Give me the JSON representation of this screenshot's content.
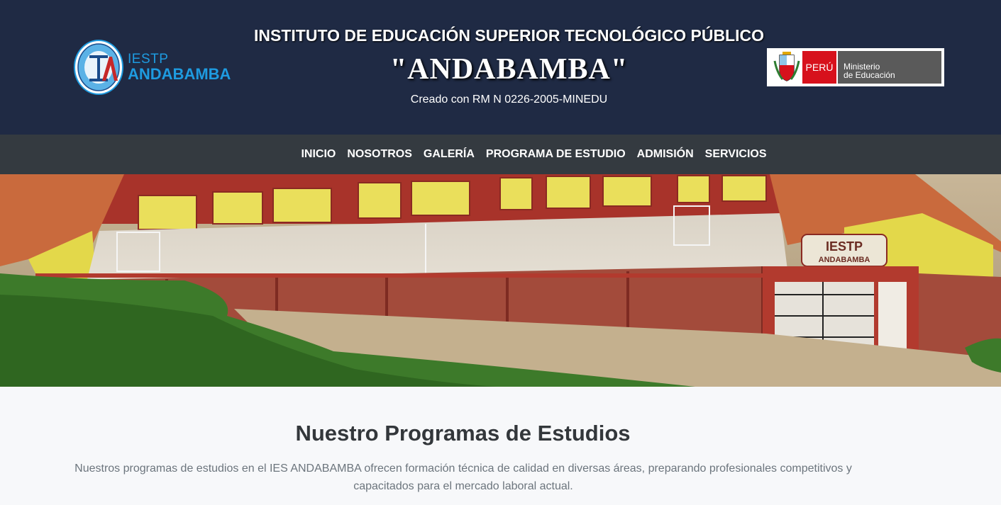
{
  "header": {
    "logo": {
      "line1": "IESTP",
      "line2": "ANDABAMBA"
    },
    "title_line1": "INSTITUTO DE EDUCACIÓN SUPERIOR TECNOLÓGICO PÚBLICO",
    "title_line2": "\"ANDABAMBA\"",
    "subtitle": "Creado con RM N 0226-2005-MINEDU",
    "minedu": {
      "country": "PERÚ",
      "line1": "Ministerio",
      "line2": "de Educación"
    },
    "bg_color": "#1f2a44"
  },
  "nav": {
    "items": [
      {
        "label": "INICIO"
      },
      {
        "label": "NOSOTROS"
      },
      {
        "label": "GALERÍA"
      },
      {
        "label": "PROGRAMA DE ESTUDIO"
      },
      {
        "label": "ADMISIÓN"
      },
      {
        "label": "SERVICIOS"
      }
    ],
    "bg_color": "#343a40"
  },
  "hero": {
    "sign_line1": "IESTP",
    "sign_line2": "ANDABAMBA"
  },
  "programs": {
    "title": "Nuestro Programas de Estudios",
    "description": "Nuestros programas de estudios en el IES ANDABAMBA ofrecen formación técnica de calidad en diversas áreas, preparando profesionales competitivos y capacitados para el mercado laboral actual."
  }
}
